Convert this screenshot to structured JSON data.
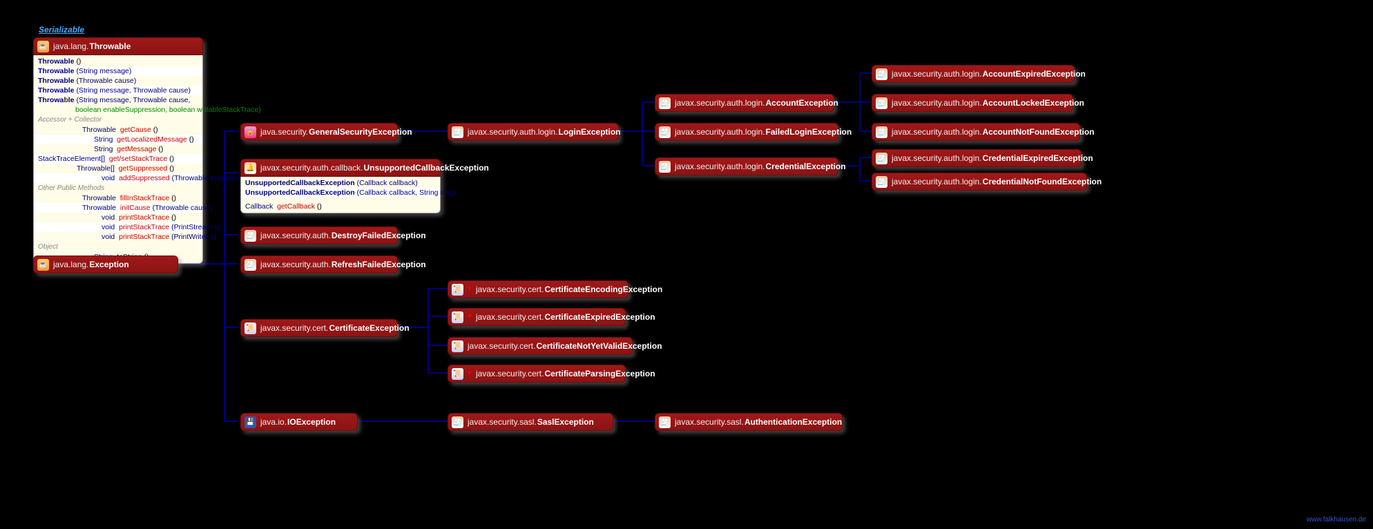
{
  "top_link": "Serializable",
  "credit": "www.falkhausen.de",
  "throwable": {
    "pkg": "java.lang.",
    "cls": "Throwable",
    "ctors": [
      {
        "n": "Throwable",
        "p": "()"
      },
      {
        "n": "Throwable",
        "p": "(String message)"
      },
      {
        "n": "Throwable",
        "p": "(Throwable cause)"
      },
      {
        "n": "Throwable",
        "p": "(String message, Throwable cause)"
      },
      {
        "n": "Throwable",
        "p": "(String message, Throwable cause,",
        "line2": "boolean enableSuppression, boolean writableStackTrace)",
        "prot": true
      }
    ],
    "cat1": "Accessor + Collector",
    "acc": [
      {
        "r": "Throwable",
        "m": "getCause",
        "p": "()"
      },
      {
        "r": "String",
        "m": "getLocalizedMessage",
        "p": "()"
      },
      {
        "r": "String",
        "m": "getMessage",
        "p": "()"
      },
      {
        "r": "StackTraceElement[]",
        "m": "get/setStackTrace",
        "p": "()"
      },
      {
        "r": "Throwable[]",
        "m": "getSuppressed",
        "p": "()"
      },
      {
        "r": "void",
        "m": "addSuppressed",
        "p": "(Throwable exception)"
      }
    ],
    "cat2": "Other Public Methods",
    "pub": [
      {
        "r": "Throwable",
        "m": "fillInStackTrace",
        "p": "()"
      },
      {
        "r": "Throwable",
        "m": "initCause",
        "p": "(Throwable cause)"
      },
      {
        "r": "void",
        "m": "printStackTrace",
        "p": "()"
      },
      {
        "r": "void",
        "m": "printStackTrace",
        "p": "(PrintStream s)"
      },
      {
        "r": "void",
        "m": "printStackTrace",
        "p": "(PrintWriter s)"
      }
    ],
    "cat3": "Object",
    "obj": [
      {
        "r": "String",
        "m": "toString",
        "p": "()"
      }
    ]
  },
  "exception": {
    "pkg": "java.lang.",
    "cls": "Exception"
  },
  "uce": {
    "pkg": "javax.security.auth.callback.",
    "cls": "UnsupportedCallbackException",
    "rows": [
      {
        "n": "UnsupportedCallbackException",
        "p": "(Callback callback)"
      },
      {
        "n": "UnsupportedCallbackException",
        "p": "(Callback callback, String msg)"
      }
    ],
    "methods": [
      {
        "r": "Callback",
        "m": "getCallback",
        "p": "()"
      }
    ]
  },
  "nodes": {
    "gse": {
      "pkg": "java.security.",
      "cls": "GeneralSecurityException",
      "icon": "lock"
    },
    "login": {
      "pkg": "javax.security.auth.login.",
      "cls": "LoginException",
      "icon": "log"
    },
    "acct": {
      "pkg": "javax.security.auth.login.",
      "cls": "AccountException",
      "icon": "log"
    },
    "failed": {
      "pkg": "javax.security.auth.login.",
      "cls": "FailedLoginException",
      "icon": "log"
    },
    "cred": {
      "pkg": "javax.security.auth.login.",
      "cls": "CredentialException",
      "icon": "log"
    },
    "acctExp": {
      "pkg": "javax.security.auth.login.",
      "cls": "AccountExpiredException",
      "icon": "log"
    },
    "acctLock": {
      "pkg": "javax.security.auth.login.",
      "cls": "AccountLockedException",
      "icon": "log"
    },
    "acctNF": {
      "pkg": "javax.security.auth.login.",
      "cls": "AccountNotFoundException",
      "icon": "log"
    },
    "credExp": {
      "pkg": "javax.security.auth.login.",
      "cls": "CredentialExpiredException",
      "icon": "log"
    },
    "credNF": {
      "pkg": "javax.security.auth.login.",
      "cls": "CredentialNotFoundException",
      "icon": "log"
    },
    "destroy": {
      "pkg": "javax.security.auth.",
      "cls": "DestroyFailedException",
      "icon": "log"
    },
    "refresh": {
      "pkg": "javax.security.auth.",
      "cls": "RefreshFailedException",
      "icon": "log"
    },
    "cert": {
      "pkg": "javax.security.cert.",
      "cls": "CertificateException",
      "icon": "cert"
    },
    "certEnc": {
      "pkg": "javax.security.cert.",
      "cls": "CertificateEncodingException",
      "icon": "cert",
      "tri": true
    },
    "certExp": {
      "pkg": "javax.security.cert.",
      "cls": "CertificateExpiredException",
      "icon": "cert",
      "tri": true
    },
    "certNYV": {
      "pkg": "javax.security.cert.",
      "cls": "CertificateNotYetValidException",
      "icon": "cert"
    },
    "certParse": {
      "pkg": "javax.security.cert.",
      "cls": "CertificateParsingException",
      "icon": "cert",
      "tri": true
    },
    "io": {
      "pkg": "java.io.",
      "cls": "IOException",
      "icon": "disk"
    },
    "sasl": {
      "pkg": "javax.security.sasl.",
      "cls": "SaslException",
      "icon": "log"
    },
    "sasla": {
      "pkg": "javax.security.sasl.",
      "cls": "AuthenticationException",
      "icon": "log"
    }
  }
}
